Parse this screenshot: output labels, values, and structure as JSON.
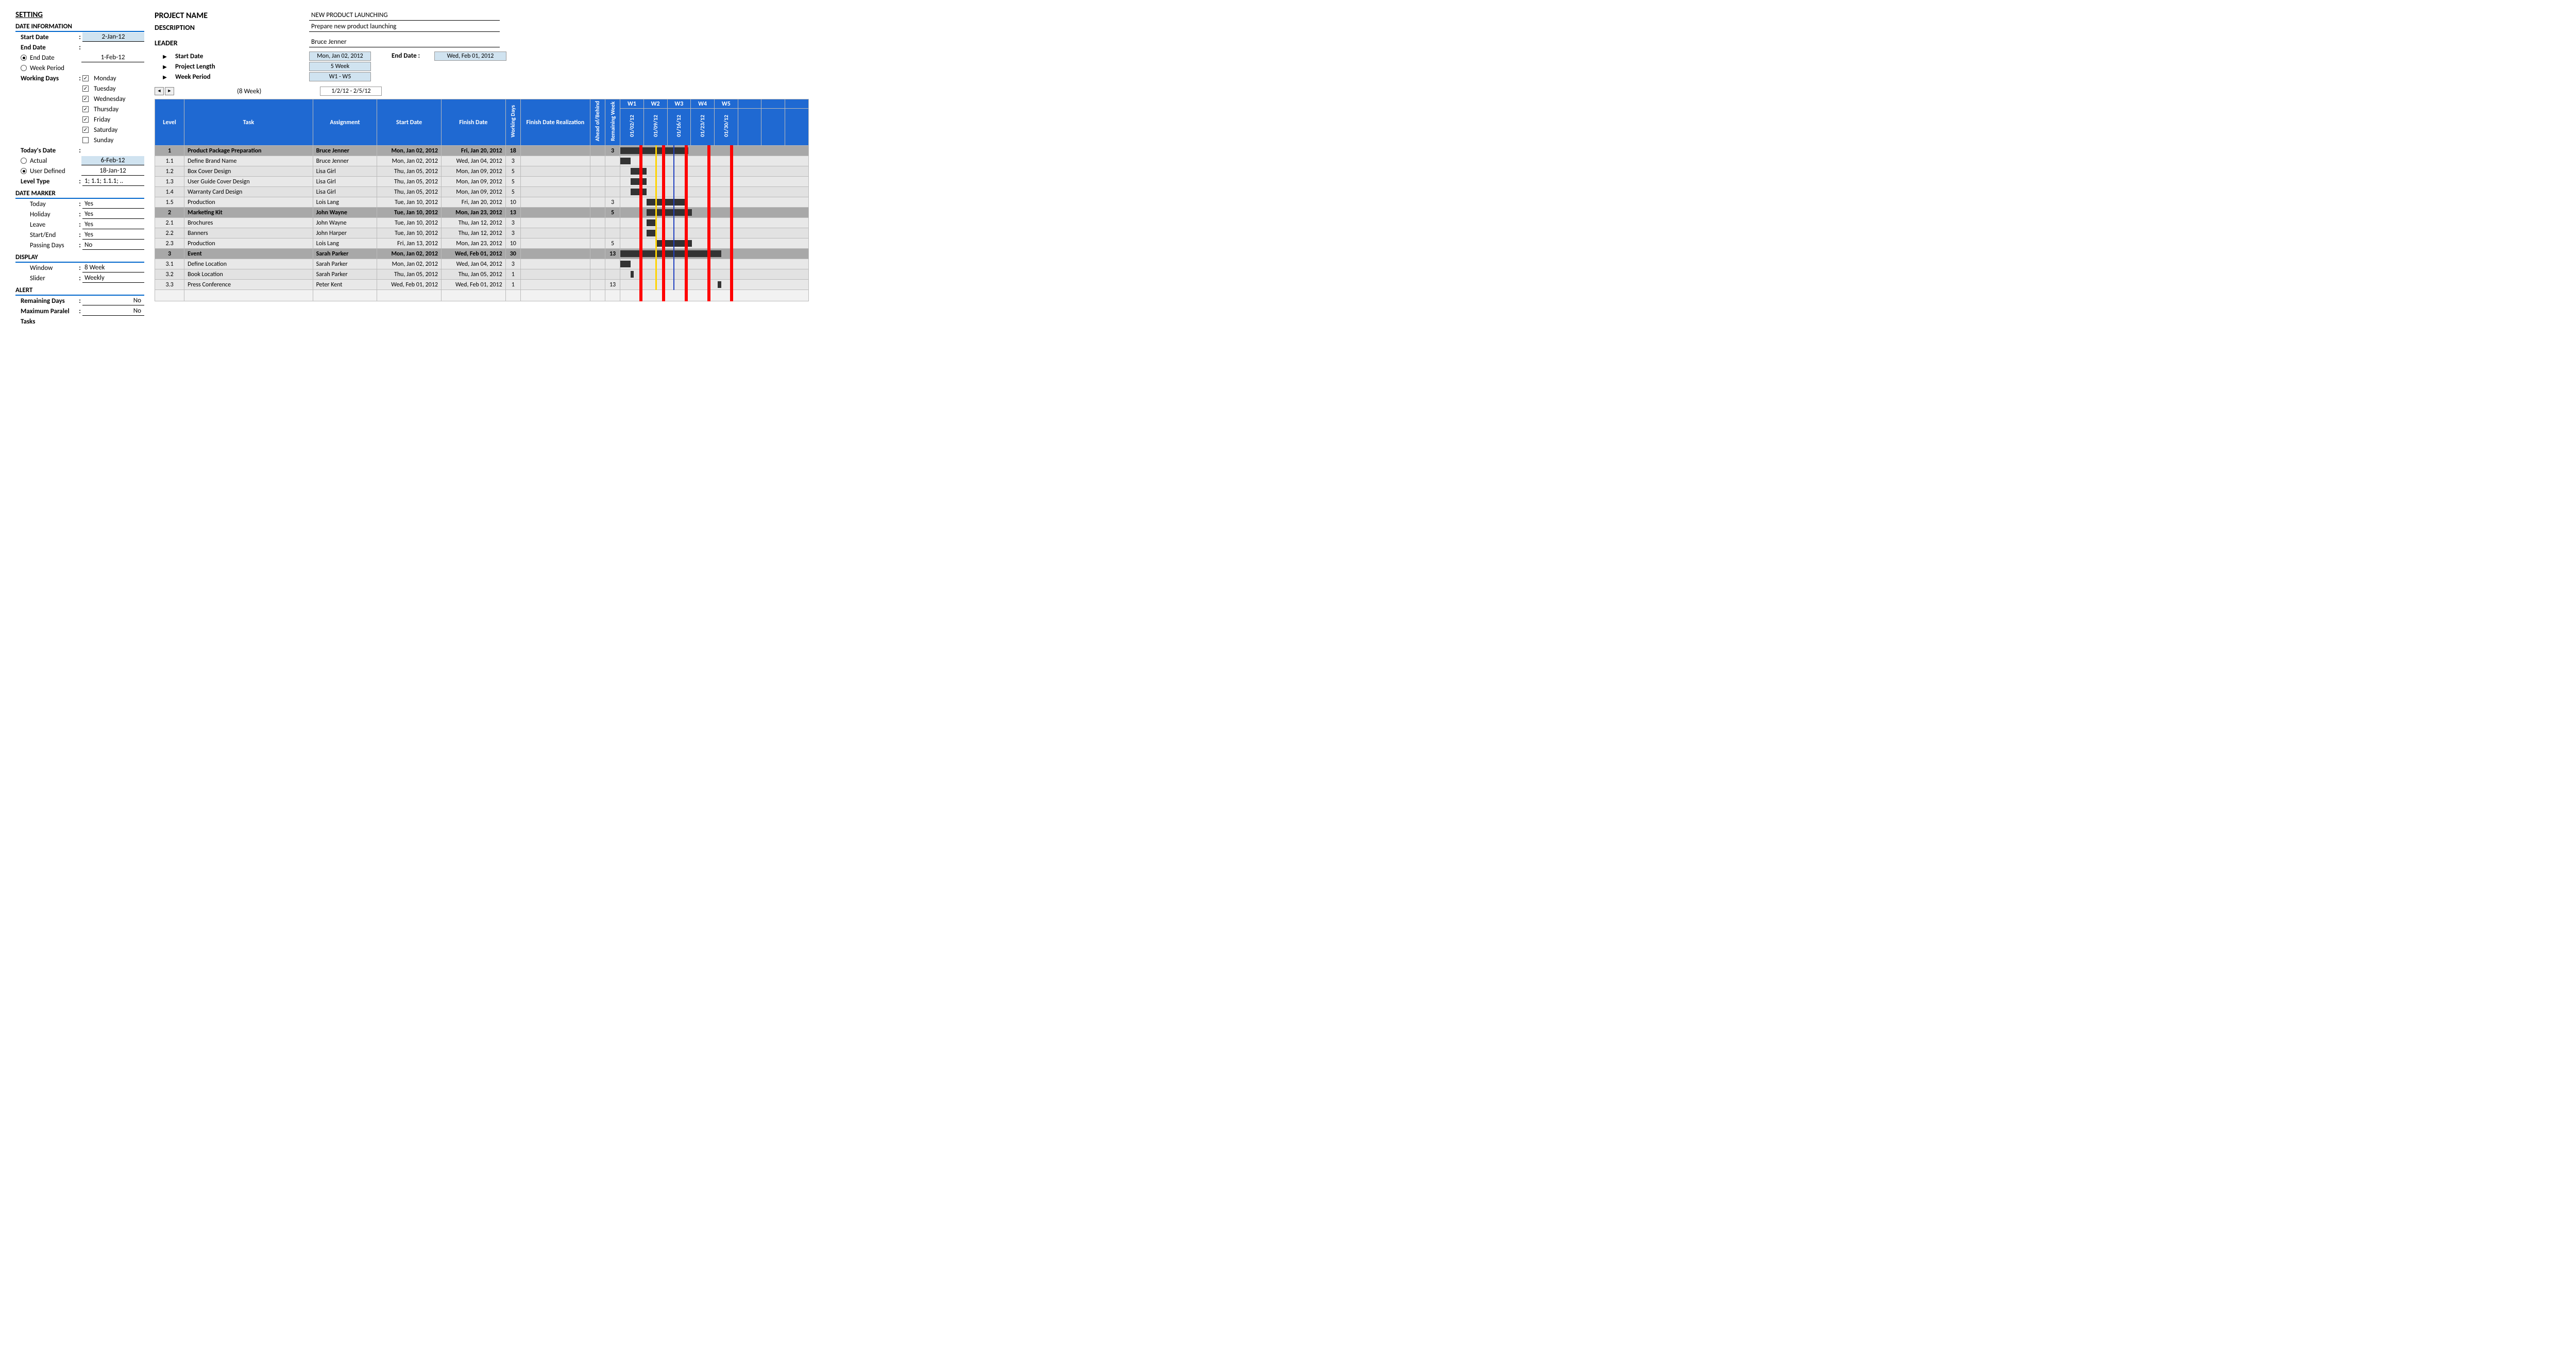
{
  "settings": {
    "heading": "SETTING",
    "date_info_title": "DATE INFORMATION",
    "start_date_lbl": "Start Date",
    "start_date_val": "2-Jan-12",
    "end_date_lbl": "End Date",
    "end_date_opt": "End Date",
    "end_date_val": "1-Feb-12",
    "week_period_opt": "Week Period",
    "working_days_lbl": "Working Days",
    "days": {
      "mon": "Monday",
      "tue": "Tuesday",
      "wed": "Wednesday",
      "thu": "Thursday",
      "fri": "Friday",
      "sat": "Saturday",
      "sun": "Sunday"
    },
    "today_lbl": "Today's Date",
    "today_actual_lbl": "Actual",
    "today_actual_val": "6-Feb-12",
    "today_user_lbl": "User Defined",
    "today_user_val": "18-Jan-12",
    "level_type_lbl": "Level Type",
    "level_type_val": "1; 1.1; 1.1.1; ..",
    "marker_title": "DATE MARKER",
    "today_m_lbl": "Today",
    "today_m_val": "Yes",
    "holiday_lbl": "Holiday",
    "holiday_val": "Yes",
    "leave_lbl": "Leave",
    "leave_val": "Yes",
    "se_lbl": "Start/End",
    "se_val": "Yes",
    "pd_lbl": "Passing Days",
    "pd_val": "No",
    "display_title": "DISPLAY",
    "window_lbl": "Window",
    "window_val": "8 Week",
    "slider_lbl": "Slider",
    "slider_val": "Weekly",
    "alert_title": "ALERT",
    "rem_lbl": "Remaining Days",
    "rem_val": "No",
    "max_lbl": "Maximum Paralel",
    "max_val": "No",
    "tasks_lbl": "Tasks"
  },
  "project": {
    "name_lbl": "PROJECT NAME",
    "name_val": "NEW PRODUCT LAUNCHING",
    "desc_lbl": "DESCRIPTION",
    "desc_val": "Prepare new product launching",
    "leader_lbl": "LEADER",
    "leader_val": "Bruce Jenner",
    "start_lbl": "Start Date",
    "start_val": "Mon, Jan 02, 2012",
    "length_lbl": "Project Length",
    "length_val": "5 Week",
    "wp_lbl": "Week Period",
    "wp_val": "W1 - W5",
    "nav_caption": "(8 Week)",
    "nav_range": "1/2/12 - 2/5/12",
    "end_lbl": "End Date :",
    "end_val": "Wed, Feb 01, 2012"
  },
  "headers": {
    "level": "Level",
    "task": "Task",
    "assign": "Assignment",
    "start": "Start Date",
    "finish": "Finish Date",
    "wd": "Working Days",
    "real": "Finish Date Realization",
    "ab": "Ahead of/Behind",
    "rem": "Remaining Week",
    "weeks": [
      "W1",
      "W2",
      "W3",
      "W4",
      "W5"
    ],
    "dates": [
      "01/02/12",
      "01/09/12",
      "01/16/12",
      "01/23/12",
      "01/30/12"
    ]
  },
  "rows": [
    {
      "p": 1,
      "level": "1",
      "task": "Product Package Preparation",
      "assign": "Bruce Jenner",
      "start": "Mon, Jan 02, 2012",
      "finish": "Fri, Jan 20, 2012",
      "wd": "18",
      "rem": "3",
      "barStart": 0,
      "barEnd": 3
    },
    {
      "p": 0,
      "level": "1.1",
      "task": "Define Brand Name",
      "assign": "Bruce Jenner",
      "start": "Mon, Jan 02, 2012",
      "finish": "Wed, Jan 04, 2012",
      "wd": "3",
      "rem": "",
      "barStart": 0,
      "barEnd": 0.45
    },
    {
      "p": 0,
      "level": "1.2",
      "task": "Box Cover Design",
      "assign": "Lisa Girl",
      "start": "Thu, Jan 05, 2012",
      "finish": "Mon, Jan 09, 2012",
      "wd": "5",
      "rem": "",
      "barStart": 0.45,
      "barEnd": 1.15
    },
    {
      "p": 0,
      "level": "1.3",
      "task": "User Guide Cover Design",
      "assign": "Lisa Girl",
      "start": "Thu, Jan 05, 2012",
      "finish": "Mon, Jan 09, 2012",
      "wd": "5",
      "rem": "",
      "barStart": 0.45,
      "barEnd": 1.15
    },
    {
      "p": 0,
      "level": "1.4",
      "task": "Warranty Card Design",
      "assign": "Lisa Girl",
      "start": "Thu, Jan 05, 2012",
      "finish": "Mon, Jan 09, 2012",
      "wd": "5",
      "rem": "",
      "barStart": 0.45,
      "barEnd": 1.15
    },
    {
      "p": 0,
      "level": "1.5",
      "task": "Production",
      "assign": "Lois Lang",
      "start": "Tue, Jan 10, 2012",
      "finish": "Fri, Jan 20, 2012",
      "wd": "10",
      "rem": "3",
      "barStart": 1.15,
      "barEnd": 2.85
    },
    {
      "p": 1,
      "level": "2",
      "task": "Marketing Kit",
      "assign": "John Wayne",
      "start": "Tue, Jan 10, 2012",
      "finish": "Mon, Jan 23, 2012",
      "wd": "13",
      "rem": "5",
      "barStart": 1.15,
      "barEnd": 3.15
    },
    {
      "p": 0,
      "level": "2.1",
      "task": "Brochures",
      "assign": "John Wayne",
      "start": "Tue, Jan 10, 2012",
      "finish": "Thu, Jan 12, 2012",
      "wd": "3",
      "rem": "",
      "barStart": 1.15,
      "barEnd": 1.6
    },
    {
      "p": 0,
      "level": "2.2",
      "task": "Banners",
      "assign": "John Harper",
      "start": "Tue, Jan 10, 2012",
      "finish": "Thu, Jan 12, 2012",
      "wd": "3",
      "rem": "",
      "barStart": 1.15,
      "barEnd": 1.6
    },
    {
      "p": 0,
      "level": "2.3",
      "task": "Production",
      "assign": "Lois Lang",
      "start": "Fri, Jan 13, 2012",
      "finish": "Mon, Jan 23, 2012",
      "wd": "10",
      "rem": "5",
      "barStart": 1.6,
      "barEnd": 3.15
    },
    {
      "p": 1,
      "level": "3",
      "task": "Event",
      "assign": "Sarah Parker",
      "start": "Mon, Jan 02, 2012",
      "finish": "Wed, Feb 01, 2012",
      "wd": "30",
      "rem": "13",
      "barStart": 0,
      "barEnd": 4.45
    },
    {
      "p": 0,
      "level": "3.1",
      "task": "Define Location",
      "assign": "Sarah Parker",
      "start": "Mon, Jan 02, 2012",
      "finish": "Wed, Jan 04, 2012",
      "wd": "3",
      "rem": "",
      "barStart": 0,
      "barEnd": 0.45
    },
    {
      "p": 0,
      "level": "3.2",
      "task": "Book Location",
      "assign": "Sarah Parker",
      "start": "Thu, Jan 05, 2012",
      "finish": "Thu, Jan 05, 2012",
      "wd": "1",
      "rem": "",
      "barStart": 0.45,
      "barEnd": 0.6
    },
    {
      "p": 0,
      "level": "3.3",
      "task": "Press Conference",
      "assign": "Peter Kent",
      "start": "Wed, Feb 01, 2012",
      "finish": "Wed, Feb 01, 2012",
      "wd": "1",
      "rem": "13",
      "barStart": 4.3,
      "barEnd": 4.45
    }
  ]
}
